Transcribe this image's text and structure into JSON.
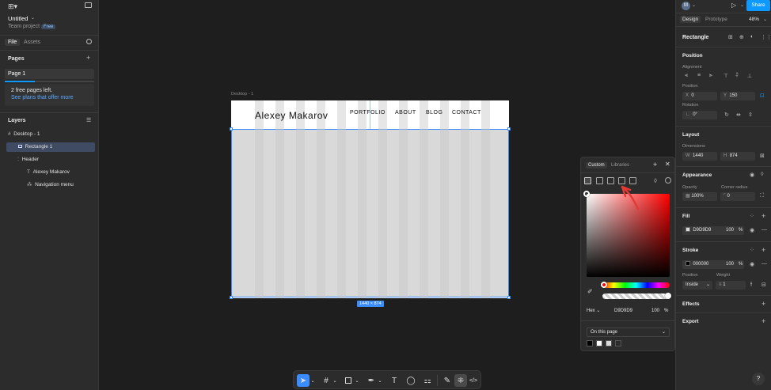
{
  "left": {
    "file_name": "Untitled",
    "project": "Team project",
    "plan_badge": "Free",
    "tabs": [
      "File",
      "Assets"
    ],
    "pages_heading": "Pages",
    "pages": [
      "Page 1"
    ],
    "upsell_line1": "2 free pages left.",
    "upsell_line2": "See plans that offer more",
    "layers_heading": "Layers",
    "layers": [
      "Desktop - 1",
      "Rectangle 1",
      "Header",
      "Alexey Makarov",
      "Navigation menu"
    ]
  },
  "canvas": {
    "frame_label": "Desktop - 1",
    "logo": "Alexey Makarov",
    "nav": [
      "PORTFOLIO",
      "ABOUT",
      "BLOG",
      "CONTACT"
    ],
    "dimension_badge": "1440 × 874"
  },
  "picker": {
    "tabs": [
      "Custom",
      "Libraries"
    ],
    "format": "Hex",
    "hex": "D9D9D9",
    "alpha": "100",
    "percent": "%",
    "library_select": "On this page",
    "swatches": [
      "#000000",
      "#ffffff",
      "#d9d9d9",
      "#2c2c2c"
    ],
    "hue_value": 0.02,
    "alpha_value": 1.0
  },
  "right": {
    "share": "Share",
    "zoom": "48%",
    "avatar": "M",
    "tabs": [
      "Design",
      "Prototype"
    ],
    "element": "Rectangle",
    "position_heading": "Position",
    "alignment_label": "Alignment",
    "position_label": "Position",
    "x_label": "X",
    "x_value": "0",
    "y_label": "Y",
    "y_value": "150",
    "rotation_label": "Rotation",
    "rotation_value": "0°",
    "layout_heading": "Layout",
    "dimensions_label": "Dimensions",
    "w_label": "W",
    "w_value": "1440",
    "h_label": "H",
    "h_value": "874",
    "appearance_heading": "Appearance",
    "opacity_label": "Opacity",
    "opacity_value": "100%",
    "radius_label": "Corner radius",
    "radius_value": "0",
    "fill_heading": "Fill",
    "fill_hex": "D9D9D9",
    "fill_opacity": "100",
    "fill_color": "#d9d9d9",
    "stroke_heading": "Stroke",
    "stroke_hex": "000000",
    "stroke_opacity": "100",
    "stroke_color": "#000000",
    "stroke_position_label": "Position",
    "stroke_weight_label": "Weight",
    "stroke_position": "Inside",
    "stroke_weight": "1",
    "effects_heading": "Effects",
    "export_heading": "Export",
    "help": "?"
  },
  "colors": {
    "accent": "#0d99ff",
    "selection": "#3b8cff",
    "annotation": "#e53935"
  }
}
